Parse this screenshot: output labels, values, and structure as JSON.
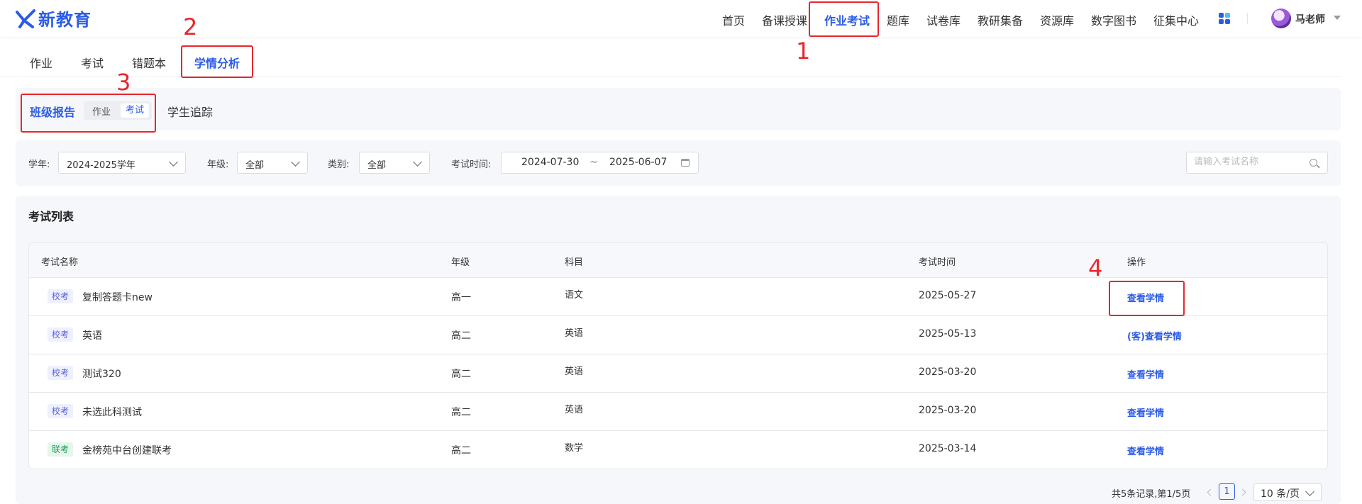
{
  "header": {
    "logo_text": "新教育",
    "nav": [
      "首页",
      "备课授课",
      "作业考试",
      "题库",
      "试卷库",
      "教研集备",
      "资源库",
      "数字图书",
      "征集中心"
    ],
    "active_nav": "作业考试",
    "user_name": "马老师"
  },
  "subtabs": [
    "作业",
    "考试",
    "错题本",
    "学情分析"
  ],
  "active_subtab": "学情分析",
  "report": {
    "title": "班级报告",
    "toggle": [
      "作业",
      "考试"
    ],
    "active_toggle": "考试",
    "track_tab": "学生追踪"
  },
  "filters": {
    "year_label": "学年:",
    "year_value": "2024-2025学年",
    "grade_label": "年级:",
    "grade_value": "全部",
    "category_label": "类别:",
    "category_value": "全部",
    "time_label": "考试时间:",
    "date_start": "2024-07-30",
    "date_sep": "~",
    "date_end": "2025-06-07",
    "search_placeholder": "请输入考试名称"
  },
  "list": {
    "title": "考试列表",
    "columns": [
      "考试名称",
      "年级",
      "科目",
      "考试时间",
      "操作"
    ],
    "rows": [
      {
        "tag": "校考",
        "tag_type": "school",
        "name": "复制答题卡new",
        "grade": "高一",
        "subject": "语文",
        "date": "2025-05-27",
        "action": "查看学情"
      },
      {
        "tag": "校考",
        "tag_type": "school",
        "name": "英语",
        "grade": "高二",
        "subject": "英语",
        "date": "2025-05-13",
        "action": "(客)查看学情"
      },
      {
        "tag": "校考",
        "tag_type": "school",
        "name": "测试320",
        "grade": "高二",
        "subject": "英语",
        "date": "2025-03-20",
        "action": "查看学情"
      },
      {
        "tag": "校考",
        "tag_type": "school",
        "name": "未选此科测试",
        "grade": "高二",
        "subject": "英语",
        "date": "2025-03-20",
        "action": "查看学情"
      },
      {
        "tag": "联考",
        "tag_type": "union",
        "name": "金榜苑中台创建联考",
        "grade": "高二",
        "subject": "数学",
        "date": "2025-03-14",
        "action": "查看学情"
      }
    ]
  },
  "pagination": {
    "info": "共5条记录,第1/5页",
    "current_page": "1",
    "page_size": "10 条/页"
  },
  "annotations": [
    "1",
    "2",
    "3",
    "4"
  ],
  "colors": {
    "accent": "#2b5ce6",
    "annotation": "#e8262d"
  }
}
